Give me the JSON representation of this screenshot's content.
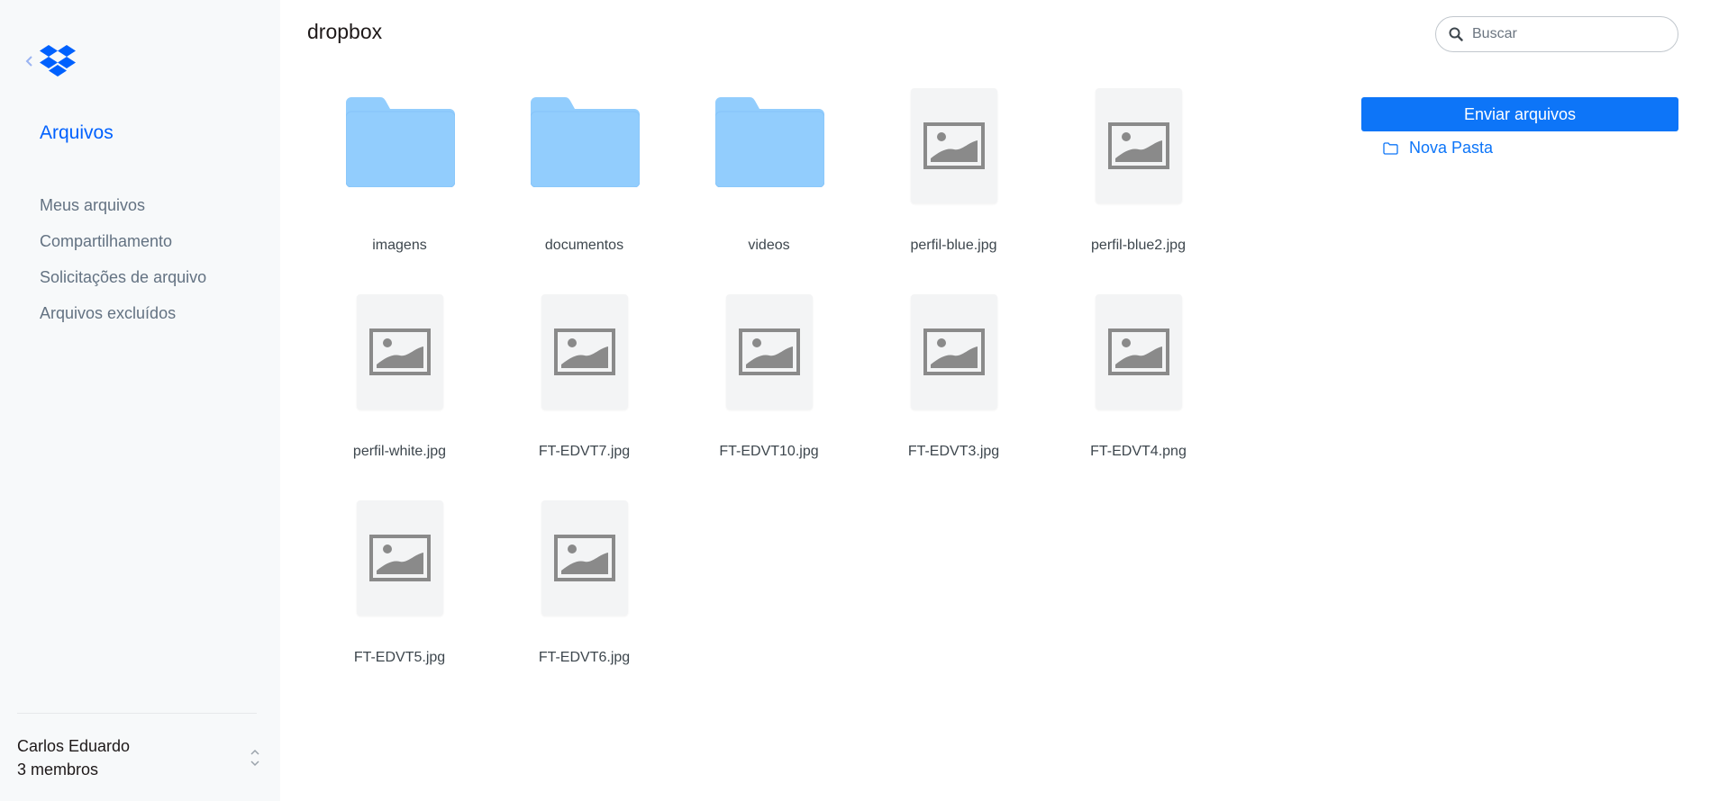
{
  "sidebar": {
    "title": "Arquivos",
    "nav": [
      {
        "label": "Meus arquivos"
      },
      {
        "label": "Compartilhamento"
      },
      {
        "label": "Solicitações de arquivo"
      },
      {
        "label": "Arquivos excluídos"
      }
    ],
    "user": {
      "name": "Carlos Eduardo",
      "members": "3 membros"
    }
  },
  "header": {
    "title": "dropbox",
    "search": {
      "placeholder": "Buscar",
      "value": ""
    }
  },
  "actions": {
    "upload_label": "Enviar arquivos",
    "new_folder_label": "Nova Pasta"
  },
  "items": [
    {
      "name": "imagens",
      "kind": "folder"
    },
    {
      "name": "documentos",
      "kind": "folder"
    },
    {
      "name": "videos",
      "kind": "folder"
    },
    {
      "name": "perfil-blue.jpg",
      "kind": "image"
    },
    {
      "name": "perfil-blue2.jpg",
      "kind": "image"
    },
    {
      "name": "perfil-white.jpg",
      "kind": "image"
    },
    {
      "name": "FT-EDVT7.jpg",
      "kind": "image"
    },
    {
      "name": "FT-EDVT10.jpg",
      "kind": "image"
    },
    {
      "name": "FT-EDVT3.jpg",
      "kind": "image"
    },
    {
      "name": "FT-EDVT4.png",
      "kind": "image"
    },
    {
      "name": "FT-EDVT5.jpg",
      "kind": "image"
    },
    {
      "name": "FT-EDVT6.jpg",
      "kind": "image"
    }
  ],
  "colors": {
    "accent": "#0d75f8",
    "folder": "#92cdfd",
    "sidebar_bg": "#f7f9fa"
  }
}
